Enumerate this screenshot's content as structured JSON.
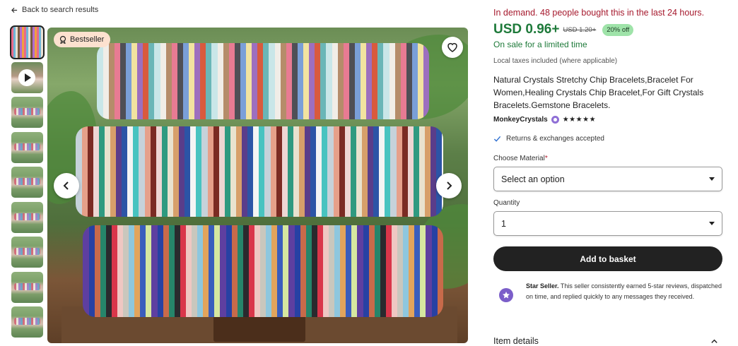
{
  "nav": {
    "back_label": "Back to search results"
  },
  "gallery": {
    "badge_label": "Bestseller",
    "thumbnail_count": 9
  },
  "listing": {
    "demand_text": "In demand. 48 people bought this in the last 24 hours.",
    "price": "USD 0.96+",
    "original_price": "USD 1.20+",
    "discount": "20% off",
    "sale_text": "On sale for a limited time",
    "taxes_text": "Local taxes included (where applicable)",
    "title": "Natural Crystals Stretchy Chip Bracelets,Bracelet For Women,Healing Crystals Chip Bracelet,For Gift Crystals Bracelets.Gemstone Bracelets.",
    "seller_name": "MonkeyCrystals",
    "rating_stars": "★★★★★",
    "returns_text": "Returns & exchanges accepted"
  },
  "options": {
    "material_label": "Choose Material",
    "material_required": "*",
    "material_value": "Select an option",
    "quantity_label": "Quantity",
    "quantity_value": "1"
  },
  "actions": {
    "add_to_basket": "Add to basket"
  },
  "star_seller": {
    "title": "Star Seller.",
    "text": "This seller consistently earned 5-star reviews, dispatched on time, and replied quickly to any messages they received."
  },
  "sections": {
    "item_details": "Item details"
  },
  "colors": {
    "price_green": "#1e7a3a",
    "demand_red": "#a61a2e",
    "discount_bg": "#9fe3a9",
    "badge_bg": "#fde1cf",
    "star_seller_purple": "#7b5ec9",
    "button_dark": "#222222"
  }
}
